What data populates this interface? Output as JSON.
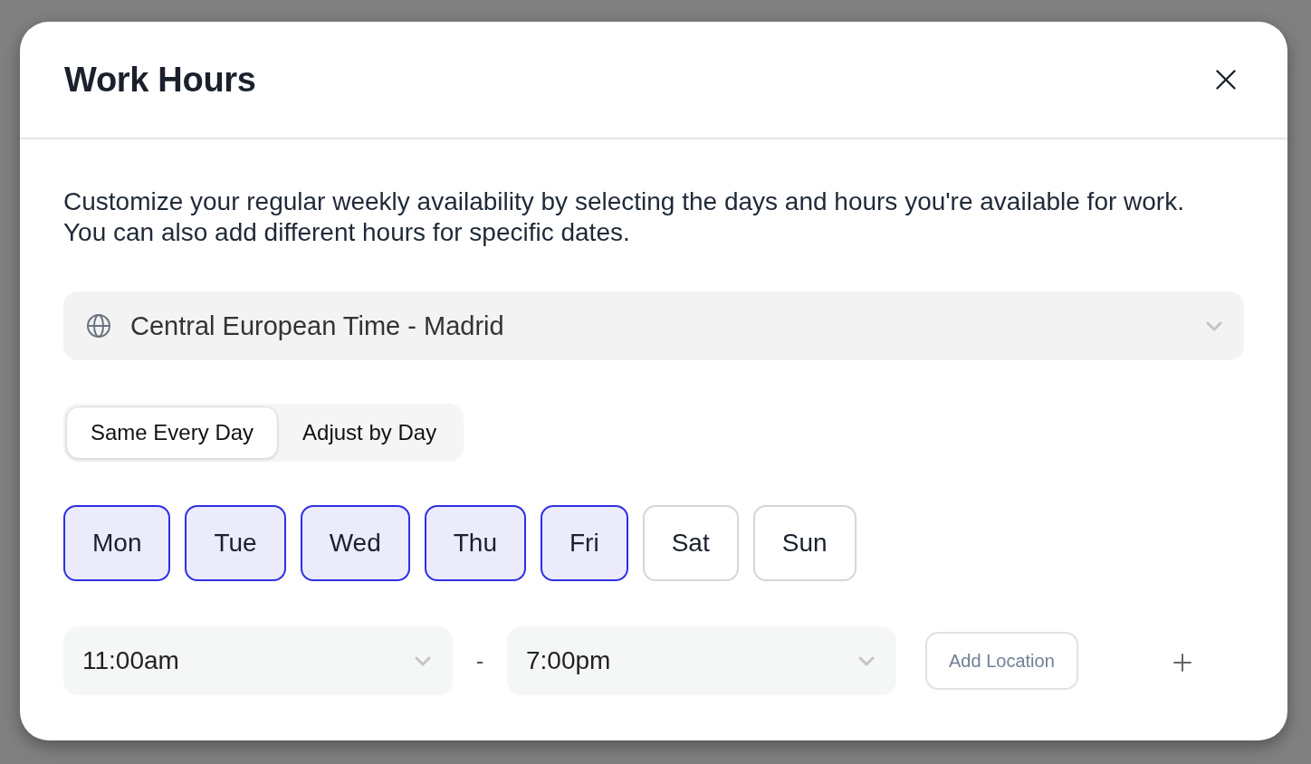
{
  "dialog": {
    "title": "Work Hours"
  },
  "description": "Customize your regular weekly availability by selecting the days and hours you're available for work.\nYou can also add different hours for specific dates.",
  "timezone": {
    "value": "Central European Time - Madrid"
  },
  "schedule_mode": [
    {
      "label": "Same Every Day",
      "selected": true
    },
    {
      "label": "Adjust by Day",
      "selected": false
    }
  ],
  "days": [
    {
      "label": "Mon",
      "selected": true
    },
    {
      "label": "Tue",
      "selected": true
    },
    {
      "label": "Wed",
      "selected": true
    },
    {
      "label": "Thu",
      "selected": true
    },
    {
      "label": "Fri",
      "selected": true
    },
    {
      "label": "Sat",
      "selected": false
    },
    {
      "label": "Sun",
      "selected": false
    }
  ],
  "time_range": {
    "start": "11:00am",
    "separator": "-",
    "end": "7:00pm"
  },
  "add_location_button": {
    "label": "Add Location"
  }
}
